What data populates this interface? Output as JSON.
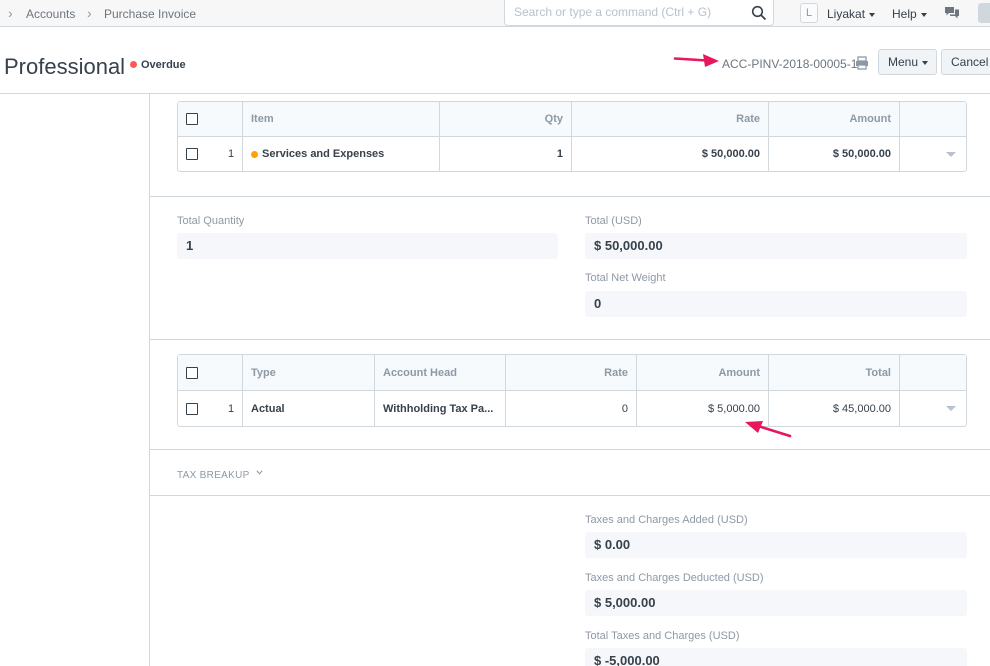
{
  "navbar": {
    "breadcrumbs": [
      "Accounts",
      "Purchase Invoice"
    ],
    "search_placeholder": "Search or type a command (Ctrl + G)",
    "avatar_initial": "L",
    "user_label": "Liyakat",
    "help_label": "Help"
  },
  "page": {
    "title": "Professional",
    "status": "Overdue",
    "doc_name": "ACC-PINV-2018-00005-1",
    "menu_label": "Menu",
    "cancel_label": "Cancel"
  },
  "items_table": {
    "headers": {
      "item": "Item",
      "qty": "Qty",
      "rate": "Rate",
      "amount": "Amount"
    },
    "rows": [
      {
        "idx": "1",
        "item": "Services and Expenses",
        "qty": "1",
        "rate": "$ 50,000.00",
        "amount": "$ 50,000.00"
      }
    ]
  },
  "totals": {
    "total_quantity_label": "Total Quantity",
    "total_quantity_value": "1",
    "total_label": "Total (USD)",
    "total_value": "$ 50,000.00",
    "total_net_weight_label": "Total Net Weight",
    "total_net_weight_value": "0"
  },
  "taxes_table": {
    "headers": {
      "type": "Type",
      "account_head": "Account Head",
      "rate": "Rate",
      "amount": "Amount",
      "total": "Total"
    },
    "rows": [
      {
        "idx": "1",
        "type": "Actual",
        "account_head": "Withholding Tax Pa...",
        "rate": "0",
        "amount": "$ 5,000.00",
        "total": "$ 45,000.00"
      }
    ]
  },
  "tax_breakup": {
    "label": "TAX BREAKUP"
  },
  "tax_totals": {
    "added_label": "Taxes and Charges Added (USD)",
    "added_value": "$ 0.00",
    "deducted_label": "Taxes and Charges Deducted (USD)",
    "deducted_value": "$ 5,000.00",
    "total_label": "Total Taxes and Charges (USD)",
    "total_value": "$ -5,000.00"
  },
  "colors": {
    "status_overdue": "#ff5858",
    "item_indicator": "#ffa00a",
    "annotation_arrow": "#e8175d"
  }
}
